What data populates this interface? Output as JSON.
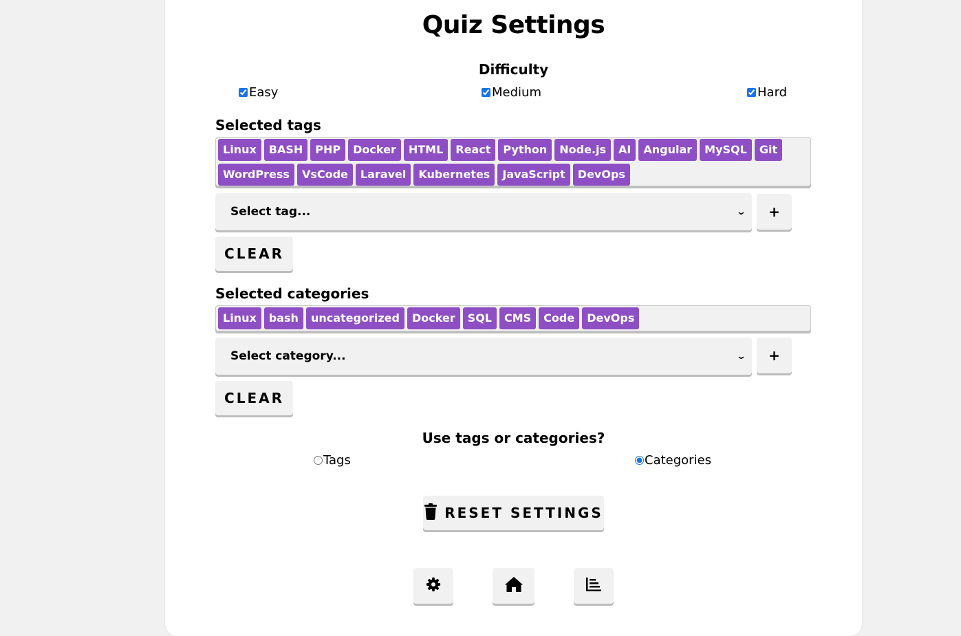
{
  "title": "Quiz Settings",
  "difficulty": {
    "heading": "Difficulty",
    "options": [
      {
        "label": "Easy",
        "checked": true
      },
      {
        "label": "Medium",
        "checked": true
      },
      {
        "label": "Hard",
        "checked": true
      }
    ]
  },
  "tags": {
    "heading": "Selected tags",
    "selected": [
      "Linux",
      "BASH",
      "PHP",
      "Docker",
      "HTML",
      "React",
      "Python",
      "Node.js",
      "AI",
      "Angular",
      "MySQL",
      "Git",
      "WordPress",
      "VsCode",
      "Laravel",
      "Kubernetes",
      "JavaScript",
      "DevOps"
    ],
    "select_placeholder": "Select tag...",
    "add_label": "+",
    "clear_label": "CLEAR"
  },
  "categories": {
    "heading": "Selected categories",
    "selected": [
      "Linux",
      "bash",
      "uncategorized",
      "Docker",
      "SQL",
      "CMS",
      "Code",
      "DevOps"
    ],
    "select_placeholder": "Select category...",
    "add_label": "+",
    "clear_label": "CLEAR"
  },
  "mode": {
    "heading": "Use tags or categories?",
    "options": [
      {
        "label": "Tags",
        "checked": false
      },
      {
        "label": "Categories",
        "checked": true
      }
    ]
  },
  "reset_label": "RESET SETTINGS",
  "icons": {
    "reset": "trash-icon",
    "nav": [
      "gear-icon",
      "home-icon",
      "chart-icon"
    ]
  },
  "colors": {
    "chip_bg": "#8e4fc4",
    "button_bg": "#f1f1f1",
    "page_bg": "#f1f1f1"
  }
}
